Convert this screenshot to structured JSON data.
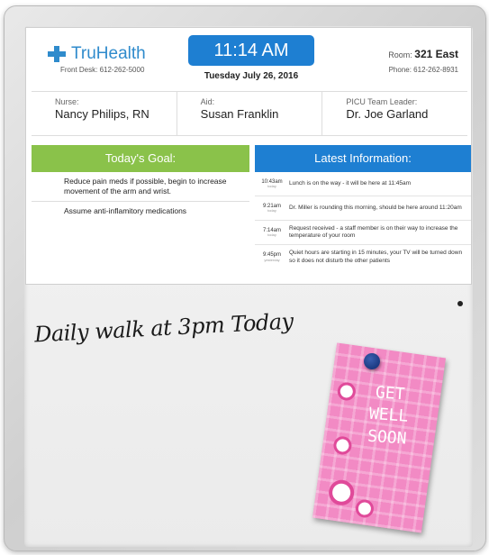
{
  "header": {
    "brand": "TruHealth",
    "front_desk": "Front Desk: 612-262-5000",
    "time": "11:14 AM",
    "date": "Tuesday July 26, 2016",
    "room_label": "Room:",
    "room_value": "321 East",
    "phone": "Phone:  612-262-8931"
  },
  "staff": [
    {
      "role": "Nurse:",
      "name": "Nancy Philips, RN"
    },
    {
      "role": "Aid:",
      "name": "Susan Franklin"
    },
    {
      "role": "PICU Team Leader:",
      "name": "Dr. Joe Garland"
    }
  ],
  "goal": {
    "title": "Today's Goal:",
    "items": [
      "Reduce pain meds if possible, begin to increase movement of the arm and wrist.",
      "Assume anti-inflamitory medications"
    ]
  },
  "info": {
    "title": "Latest Information:",
    "items": [
      {
        "time": "10:43am",
        "day": "today",
        "text": "Lunch is on the way - it will be here at 11:45am"
      },
      {
        "time": "9:21am",
        "day": "today",
        "text": "Dr. Miller is rounding this morning, should be here around 11:20am"
      },
      {
        "time": "7:14am",
        "day": "today",
        "text": "Request received - a staff member is on their way to increase the temperature of your room"
      },
      {
        "time": "9:45pm",
        "day": "yesterday",
        "text": "Quiet hours are starting in 15 minutes, your TV will be turned down so it does not disturb the other patients"
      }
    ]
  },
  "whiteboard": {
    "note": "Daily walk at 3pm Today",
    "card_text": "GET WELL SOON"
  },
  "colors": {
    "brand_blue": "#1e7fd2",
    "goal_green": "#8ac24a",
    "card_pink": "#f28ac4"
  }
}
